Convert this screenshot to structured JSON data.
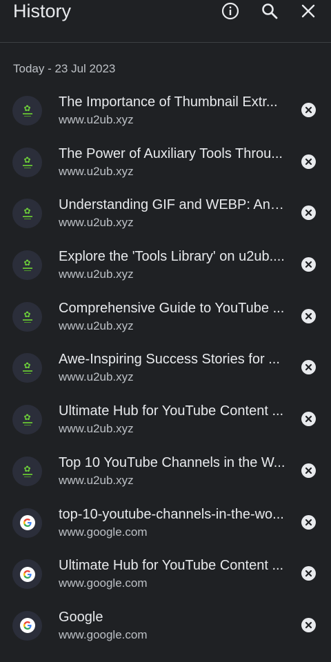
{
  "header": {
    "title": "History",
    "icons": [
      "info-icon",
      "search-icon",
      "close-icon"
    ]
  },
  "section": {
    "label": "Today - 23 Jul 2023"
  },
  "items": [
    {
      "title": "The Importance of Thumbnail Extr...",
      "url": "www.u2ub.xyz",
      "favicon": "u2ub-logo-icon"
    },
    {
      "title": "The Power of Auxiliary Tools Throu...",
      "url": "www.u2ub.xyz",
      "favicon": "u2ub-logo-icon"
    },
    {
      "title": "Understanding GIF and WEBP: An I...",
      "url": "www.u2ub.xyz",
      "favicon": "u2ub-logo-icon"
    },
    {
      "title": "Explore the 'Tools Library' on u2ub....",
      "url": "www.u2ub.xyz",
      "favicon": "u2ub-logo-icon"
    },
    {
      "title": "Comprehensive Guide to YouTube ...",
      "url": "www.u2ub.xyz",
      "favicon": "u2ub-logo-icon"
    },
    {
      "title": "Awe-Inspiring Success Stories for ...",
      "url": "www.u2ub.xyz",
      "favicon": "u2ub-logo-icon"
    },
    {
      "title": "Ultimate Hub for YouTube Content ...",
      "url": "www.u2ub.xyz",
      "favicon": "u2ub-logo-icon"
    },
    {
      "title": "Top 10 YouTube Channels in the W...",
      "url": "www.u2ub.xyz",
      "favicon": "u2ub-logo-icon"
    },
    {
      "title": "top-10-youtube-channels-in-the-wo...",
      "url": "www.google.com",
      "favicon": "google-icon"
    },
    {
      "title": "Ultimate Hub for YouTube Content ...",
      "url": "www.google.com",
      "favicon": "google-icon"
    },
    {
      "title": "Google",
      "url": "www.google.com",
      "favicon": "google-icon"
    }
  ],
  "colors": {
    "background": "#1f2124",
    "text_primary": "#e8eaed",
    "text_secondary": "#bdc1c6",
    "favicon_bg": "#2b2e3a"
  }
}
